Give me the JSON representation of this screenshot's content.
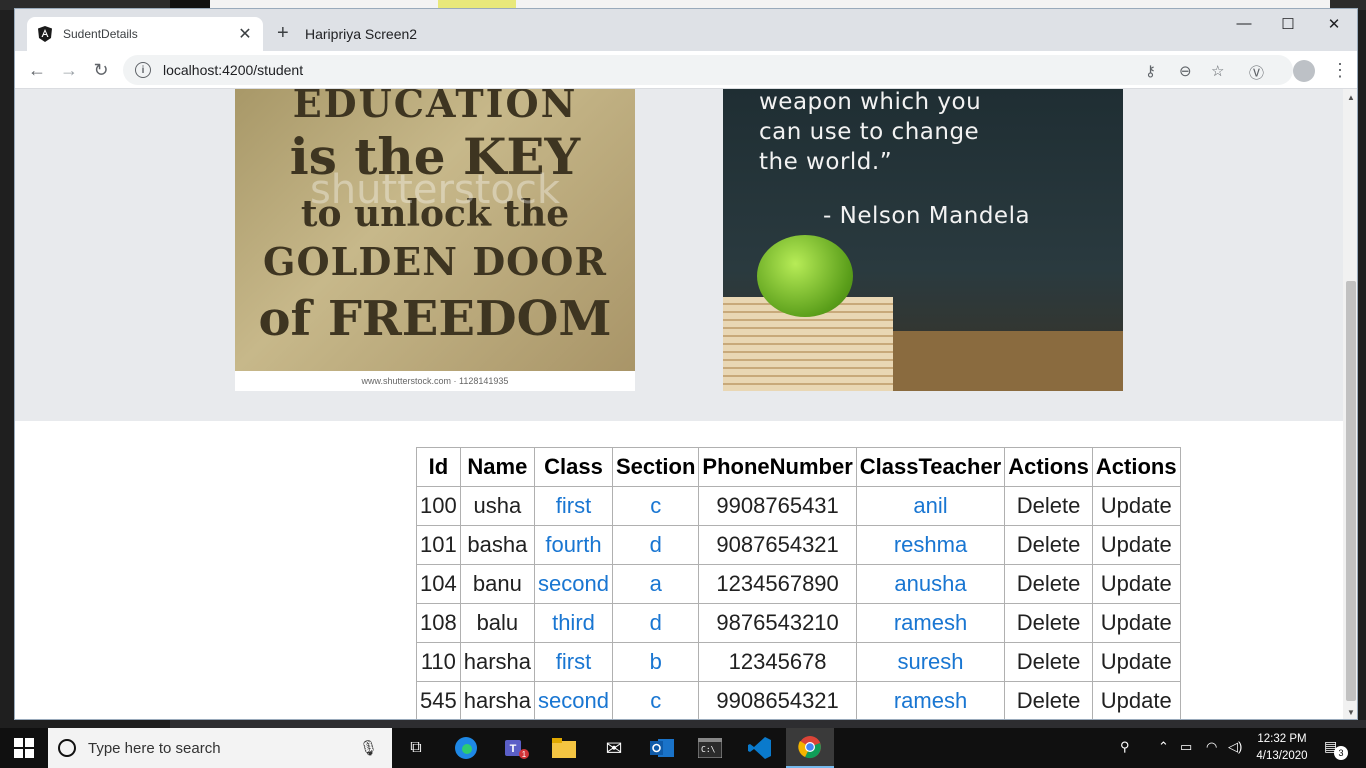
{
  "browser": {
    "tab": {
      "title": "SudentDetails"
    },
    "other_tab": {
      "title": "Haripriya Screen2"
    },
    "url": "localhost:4200/student"
  },
  "images": {
    "left": {
      "lines": [
        "EDUCATION",
        "is the KEY",
        "to unlock the",
        "GOLDEN DOOR",
        "of FREEDOM"
      ],
      "watermark": "shutterstock",
      "credit": "www.shutterstock.com · 1128141935"
    },
    "right": {
      "lines": [
        "weapon which you",
        "can use to change",
        "the world.”"
      ],
      "author": "- Nelson Mandela"
    }
  },
  "table": {
    "headers": [
      "Id",
      "Name",
      "Class",
      "Section",
      "PhoneNumber",
      "ClassTeacher",
      "Actions",
      "Actions"
    ],
    "rows": [
      {
        "id": "100",
        "name": "usha",
        "class": "first",
        "section": "c",
        "phone": "9908765431",
        "teacher": "anil",
        "delete": "Delete",
        "update": "Update"
      },
      {
        "id": "101",
        "name": "basha",
        "class": "fourth",
        "section": "d",
        "phone": "9087654321",
        "teacher": "reshma",
        "delete": "Delete",
        "update": "Update"
      },
      {
        "id": "104",
        "name": "banu",
        "class": "second",
        "section": "a",
        "phone": "1234567890",
        "teacher": "anusha",
        "delete": "Delete",
        "update": "Update"
      },
      {
        "id": "108",
        "name": "balu",
        "class": "third",
        "section": "d",
        "phone": "9876543210",
        "teacher": "ramesh",
        "delete": "Delete",
        "update": "Update"
      },
      {
        "id": "110",
        "name": "harsha",
        "class": "first",
        "section": "b",
        "phone": "12345678",
        "teacher": "suresh",
        "delete": "Delete",
        "update": "Update"
      },
      {
        "id": "545",
        "name": "harsha",
        "class": "second",
        "section": "c",
        "phone": "9908654321",
        "teacher": "ramesh",
        "delete": "Delete",
        "update": "Update"
      }
    ]
  },
  "taskbar": {
    "search_placeholder": "Type here to search",
    "time": "12:32 PM",
    "date": "4/13/2020",
    "notification_count": "3",
    "teams_badge": "1"
  },
  "colors": {
    "link": "#1976d2",
    "banner_bg": "#e8eaed"
  }
}
